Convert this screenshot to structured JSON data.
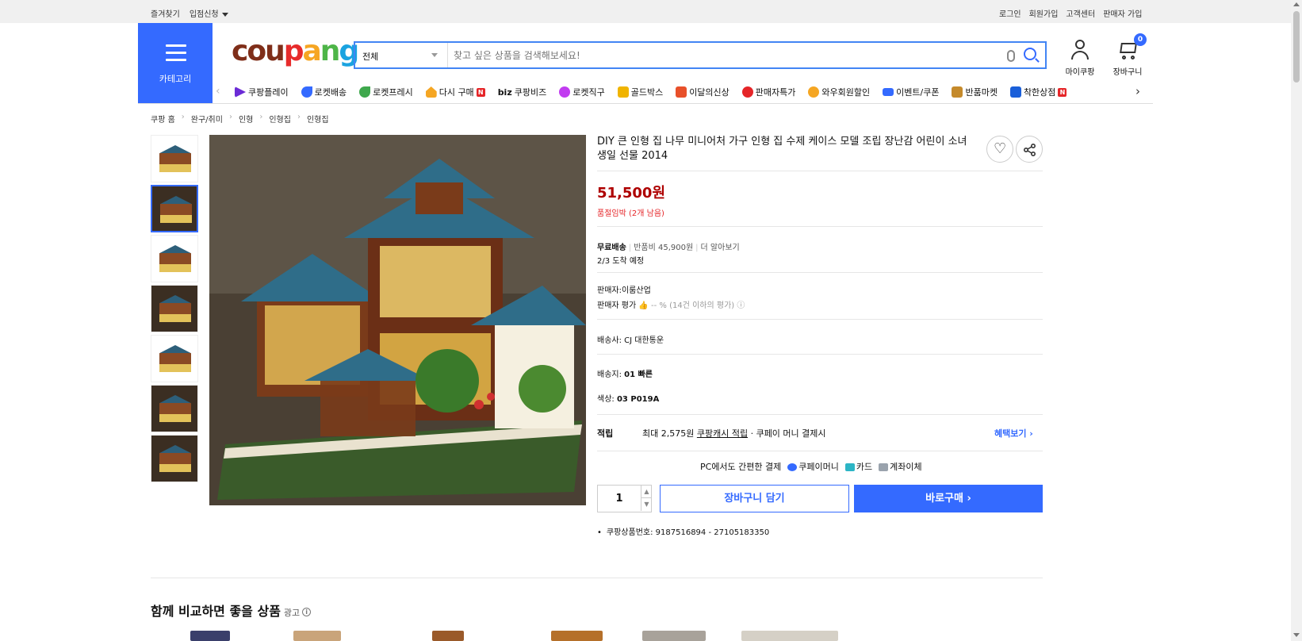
{
  "topbar": {
    "left": [
      "즐겨찾기",
      "입점신청"
    ],
    "right": [
      "로그인",
      "회원가입",
      "고객센터",
      "판매자 가입"
    ]
  },
  "header": {
    "category_label": "카테고리",
    "logo": {
      "c1": "cou",
      "c2": "p",
      "c3": "a",
      "c4": "n",
      "c5": "g"
    },
    "search_category": "전체",
    "search_placeholder": "찾고 싶은 상품을 검색해보세요!",
    "my_label": "마이쿠팡",
    "cart_label": "장바구니",
    "cart_count": "0"
  },
  "nav": {
    "items": [
      {
        "label": "쿠팡플레이",
        "color": "#6b2bd6"
      },
      {
        "label": "로켓배송",
        "color": "#346aff"
      },
      {
        "label": "로켓프레시",
        "color": "#3fa84d"
      },
      {
        "label": "다시 구매",
        "color": "#f5a623"
      },
      {
        "label": "쿠팡비즈",
        "prefix": "biz",
        "color": "#111111"
      },
      {
        "label": "로켓직구",
        "color": "#c13cf0"
      },
      {
        "label": "골드박스",
        "color": "#f0b400"
      },
      {
        "label": "이달의신상",
        "color": "#e8502a"
      },
      {
        "label": "판매자특가",
        "color": "#e52528"
      },
      {
        "label": "와우회원할인",
        "color": "#f5a623"
      },
      {
        "label": "이벤트/쿠폰",
        "color": "#346aff"
      },
      {
        "label": "반품마켓",
        "color": "#c58a2b"
      },
      {
        "label": "착한상점",
        "color": "#1a5fd9"
      }
    ]
  },
  "breadcrumb": [
    "쿠팡 홈",
    "완구/취미",
    "인형",
    "인형집",
    "인형집"
  ],
  "product": {
    "title": "DIY 큰 인형 집 나무 미니어처 가구 인형 집 수제 케이스 모델 조립 장난감 어린이 소녀 생일 선물 2014",
    "price": "51,500원",
    "stock": "품절임박 (2개 남음)",
    "free_ship": "무료배송",
    "return_fee": "반품비 45,900원",
    "more": "더 알아보기",
    "arrival": "2/3 도착 예정",
    "seller": "판매자:이룸산업",
    "seller_rating_label": "판매자 평가",
    "seller_rating_value": "-- % (14건 이하의 평가)",
    "carrier_label": "배송사:",
    "carrier": "CJ 대한통운",
    "option1_label": "배송지:",
    "option1": "01 빠른",
    "option2_label": "색상:",
    "option2": "03 P019A",
    "points_label": "적립",
    "points_text": "최대 2,575원",
    "points_link": "쿠팡캐시 적립",
    "points_tail": " · 쿠페이 머니 결제시",
    "benefit": "혜택보기 ›",
    "pay_label": "PC에서도 간편한 결제",
    "pay_methods": [
      "쿠페이머니",
      "카드",
      "계좌이체"
    ],
    "qty": "1",
    "cart_btn": "장바구니 담기",
    "buy_btn": "바로구매 ›",
    "product_no": "쿠팡상품번호: 9187516894 - 27105183350"
  },
  "compare": {
    "title": "함께 비교하면 좋을 상품",
    "ad": "광고"
  }
}
